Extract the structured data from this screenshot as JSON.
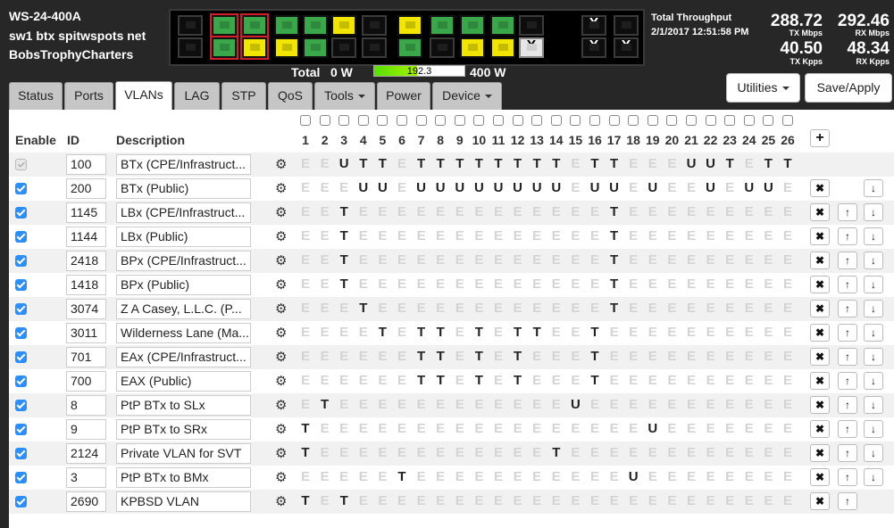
{
  "device": {
    "model": "WS-24-400A",
    "name": "sw1 btx spitwspots net",
    "owner": "BobsTrophyCharters"
  },
  "panel": {
    "ports": [
      {
        "c": "k"
      },
      {
        "c": "g",
        "red": true
      },
      {
        "c": "g",
        "red": true
      },
      {
        "c": "g"
      },
      {
        "c": "g"
      },
      {
        "c": "y"
      },
      {
        "c": "k"
      },
      {
        "c": "y"
      },
      {
        "c": "g"
      },
      {
        "c": "g"
      },
      {
        "c": "g"
      },
      {
        "c": "k"
      },
      {
        "c": "k",
        "x": "X"
      },
      {
        "c": "k"
      },
      {
        "c": "k"
      },
      {
        "c": "g",
        "red": true
      },
      {
        "c": "y",
        "red": true
      },
      {
        "c": "y"
      },
      {
        "c": "g"
      },
      {
        "c": "k"
      },
      {
        "c": "k"
      },
      {
        "c": "g"
      },
      {
        "c": "k"
      },
      {
        "c": "y"
      },
      {
        "c": "y"
      },
      {
        "c": "w",
        "x": "X"
      },
      {
        "c": "k",
        "x": "X"
      },
      {
        "c": "k",
        "x": "X"
      }
    ]
  },
  "throughput": {
    "title": "Total Throughput",
    "timestamp": "2/1/2017 12:51:58 PM",
    "tx_mbps": "288.72",
    "tx_mbps_label": "TX Mbps",
    "rx_mbps": "292.46",
    "rx_mbps_label": "RX Mbps",
    "tx_kpps": "40.50",
    "tx_kpps_label": "TX Kpps",
    "rx_kpps": "48.34",
    "rx_kpps_label": "RX Kpps"
  },
  "power": {
    "label": "Total",
    "min": "0 W",
    "value": "192.3",
    "fraction": 0.48,
    "max": "400 W"
  },
  "tabs": [
    {
      "label": "Status"
    },
    {
      "label": "Ports"
    },
    {
      "label": "VLANs",
      "active": true
    },
    {
      "label": "LAG"
    },
    {
      "label": "STP"
    },
    {
      "label": "QoS"
    },
    {
      "label": "Tools",
      "dropdown": true
    },
    {
      "label": "Power"
    },
    {
      "label": "Device",
      "dropdown": true
    }
  ],
  "actions": {
    "utilities": "Utilities",
    "save": "Save/Apply"
  },
  "table": {
    "headers": {
      "enable": "Enable",
      "id": "ID",
      "description": "Description",
      "add": "+"
    },
    "ports": [
      "1",
      "2",
      "3",
      "4",
      "5",
      "6",
      "7",
      "8",
      "9",
      "10",
      "11",
      "12",
      "13",
      "14",
      "15",
      "16",
      "17",
      "18",
      "19",
      "20",
      "21",
      "22",
      "23",
      "24",
      "25",
      "26"
    ],
    "rows": [
      {
        "state": "dis",
        "id": "100",
        "desc": "BTx (CPE/Infrastruct...",
        "m": "EEUTTETTTTTTTTETTEEEUUTETT",
        "del": false,
        "up": false,
        "down": false
      },
      {
        "state": "on",
        "id": "200",
        "desc": "BTx (Public)",
        "m": "EEEUUEUUUUUUUUEUUEUEEUEUUE",
        "del": true,
        "up": false,
        "down": true
      },
      {
        "state": "on",
        "id": "1145",
        "desc": "LBx (CPE/Infrastruct...",
        "m": "EETEEEEEEEEEEEEETEEEEEEEEE",
        "del": true,
        "up": true,
        "down": true
      },
      {
        "state": "on",
        "id": "1144",
        "desc": "LBx (Public)",
        "m": "EETEEEEEEEEEEEEETEEEEEEEEE",
        "del": true,
        "up": true,
        "down": true
      },
      {
        "state": "on",
        "id": "2418",
        "desc": "BPx (CPE/Infrastruct...",
        "m": "EETEEEEEEEEEEEEETEEEEEEEEE",
        "del": true,
        "up": true,
        "down": true
      },
      {
        "state": "on",
        "id": "1418",
        "desc": "BPx (Public)",
        "m": "EETEEEEEEEEEEEEETEEEEEEEEE",
        "del": true,
        "up": true,
        "down": true
      },
      {
        "state": "on",
        "id": "3074",
        "desc": "Z A Casey, L.L.C. (P...",
        "m": "EEETEEEEEEEEEEEETEEEEEEEEE",
        "del": true,
        "up": true,
        "down": true
      },
      {
        "state": "on",
        "id": "3011",
        "desc": "Wilderness Lane (Ma...",
        "m": "EEEETETTETETTEETEEEEEEEEEE",
        "del": true,
        "up": true,
        "down": true
      },
      {
        "state": "on",
        "id": "701",
        "desc": "EAx (CPE/Infrastruct...",
        "m": "EEEEEETTETETEEETEEEEEEEEEE",
        "del": true,
        "up": true,
        "down": true
      },
      {
        "state": "on",
        "id": "700",
        "desc": "EAX (Public)",
        "m": "EEEEEETTETETEEETEEEEEEEEEE",
        "del": true,
        "up": true,
        "down": true
      },
      {
        "state": "on",
        "id": "8",
        "desc": "PtP BTx to SLx",
        "m": "ETEEEEEEEEEEEEUEEEEEEEEEEE",
        "del": true,
        "up": true,
        "down": true
      },
      {
        "state": "on",
        "id": "9",
        "desc": "PtP BTx to SRx",
        "m": "TEEEEEEEEEEEEEEEEEUEEEEEEE",
        "del": true,
        "up": true,
        "down": true
      },
      {
        "state": "on",
        "id": "2124",
        "desc": "Private VLAN for SVT",
        "m": "TEEEEEEEEEEEETEEEEEEEEEEEE",
        "del": true,
        "up": true,
        "down": true
      },
      {
        "state": "on",
        "id": "3",
        "desc": "PtP BTx to BMx",
        "m": "EEEEETEEEEEEEEEEEUEEEEEEEE",
        "del": true,
        "up": true,
        "down": true
      },
      {
        "state": "on",
        "id": "2690",
        "desc": "KPBSD VLAN",
        "m": "TETEEEEEEEEEEEEEEEEEEEEEEE",
        "del": true,
        "up": true,
        "down": false
      }
    ]
  }
}
